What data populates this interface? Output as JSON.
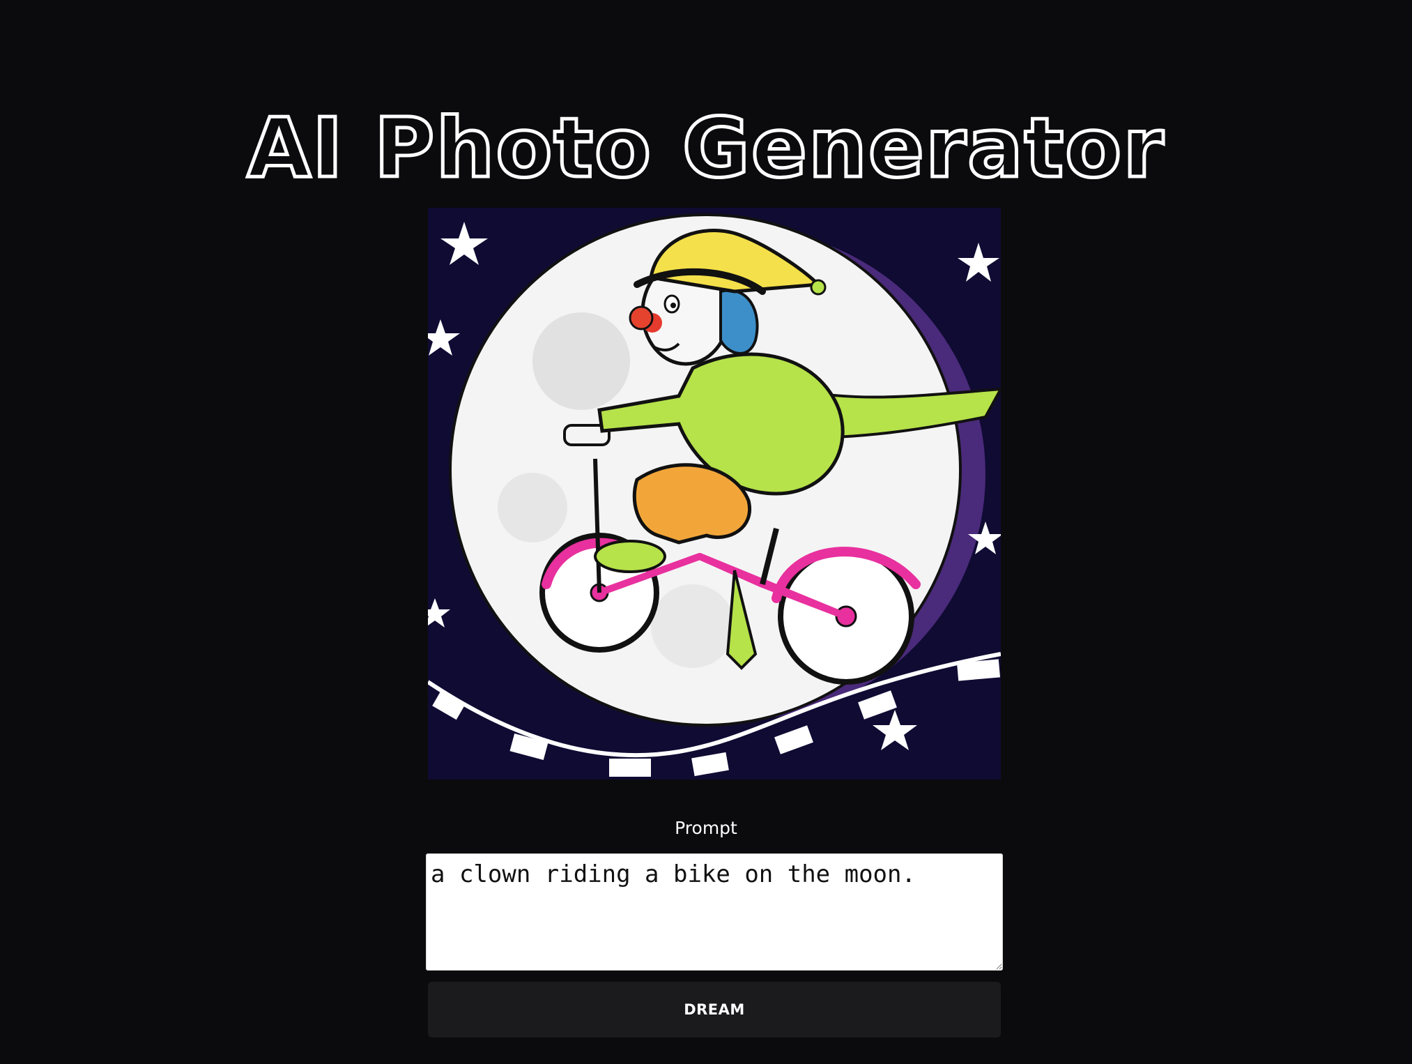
{
  "header": {
    "title": "AI Photo Generator"
  },
  "generated_image": {
    "subject": "clown riding a bike in front of the moon"
  },
  "prompt": {
    "label": "Prompt",
    "value": "a clown riding a bike on the moon."
  },
  "actions": {
    "dream_label": "DREAM"
  },
  "colors": {
    "page_background": "#0b0b0d",
    "button_background": "#1b1b1d",
    "night_sky": "#0f0b33",
    "moon_shadow": "#4a2a7a",
    "clown_jacket": "#b6e24a",
    "clown_pants": "#f2a63a",
    "bike_frame": "#e8309e",
    "clown_hat": "#f4e04a",
    "clown_hair": "#3d8fc9"
  }
}
